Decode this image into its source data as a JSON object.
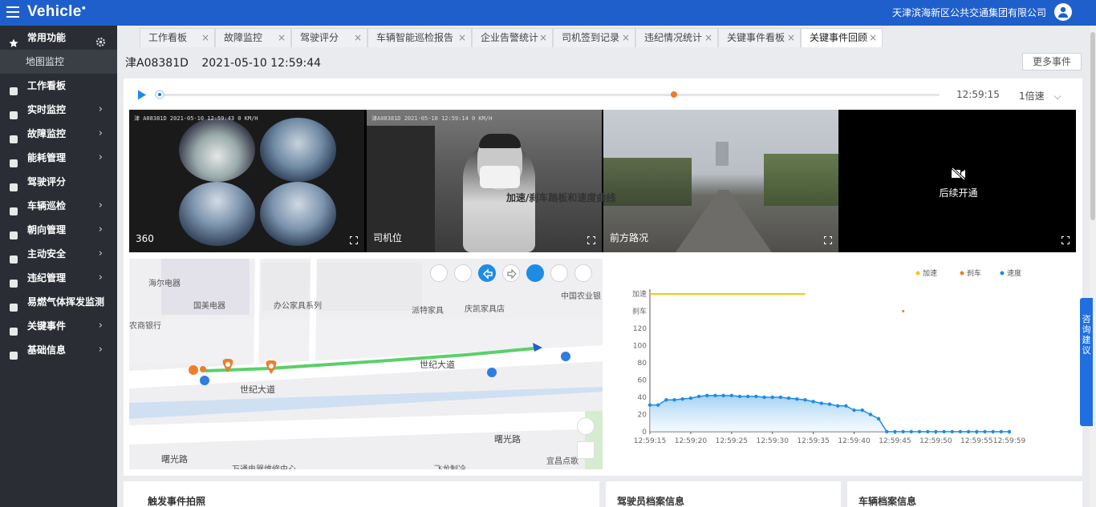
{
  "app": {
    "logo": "Vehicle",
    "company": "天津滨海新区公共交通集团有限公司"
  },
  "sidebar": {
    "items": [
      {
        "label": "常用功能",
        "icon": "star-icon",
        "expandable": false,
        "gear": true
      },
      {
        "label": "工作看板",
        "icon": "board-icon",
        "expandable": false
      },
      {
        "label": "实时监控",
        "icon": "monitor-icon",
        "expandable": true
      },
      {
        "label": "故障监控",
        "icon": "fault-icon",
        "expandable": true
      },
      {
        "label": "能耗管理",
        "icon": "energy-icon",
        "expandable": true
      },
      {
        "label": "驾驶评分",
        "icon": "steering-icon",
        "expandable": false
      },
      {
        "label": "车辆巡检",
        "icon": "bus-icon",
        "expandable": true
      },
      {
        "label": "朝向管理",
        "icon": "compass-icon",
        "expandable": true
      },
      {
        "label": "主动安全",
        "icon": "shield-icon",
        "expandable": true
      },
      {
        "label": "违纪管理",
        "icon": "violation-icon",
        "expandable": true
      },
      {
        "label": "易燃气体挥发监测",
        "icon": "gas-icon",
        "expandable": false
      },
      {
        "label": "关键事件",
        "icon": "event-icon",
        "expandable": true
      },
      {
        "label": "基础信息",
        "icon": "user-info-icon",
        "expandable": true
      }
    ],
    "sub_item": "地图监控"
  },
  "tabs": [
    {
      "label": "工作看板"
    },
    {
      "label": "故障监控"
    },
    {
      "label": "驾驶评分"
    },
    {
      "label": "车辆智能巡检报告"
    },
    {
      "label": "企业告警统计"
    },
    {
      "label": "司机签到记录"
    },
    {
      "label": "违纪情况统计"
    },
    {
      "label": "关键事件看板"
    },
    {
      "label": "关键事件回顾",
      "active": true
    }
  ],
  "header": {
    "plate": "津A08381D",
    "datetime": "2021-05-10 12:59:44",
    "more_events": "更多事件"
  },
  "player": {
    "time": "12:59:15",
    "speed": "1倍速",
    "progress": 0.0,
    "event_marker": 0.66
  },
  "videos": [
    {
      "label": "360",
      "osd": "津 A08381D   2021-05-10  12:59:43    0 KM/H"
    },
    {
      "label": "司机位",
      "osd": "津A08381D      2021-05-10 12:59:14        0 KM/H"
    },
    {
      "label": "前方路况",
      "osd": ""
    },
    {
      "label": "后续开通",
      "placeholder": true
    }
  ],
  "map": {
    "labels": [
      "海尔电器",
      "国美电器",
      "办公家具系列",
      "派特家具",
      "庆凯家具店",
      "中国农业银",
      "农商银行",
      "世纪大道",
      "世纪大道",
      "曙光路",
      "曙光路",
      "万通电器维修中心",
      "飞龙制冷",
      "宜昌点歌"
    ]
  },
  "chart_data": {
    "type": "line",
    "title": "加速/刹车踏板和速度曲线",
    "legend": [
      "加速",
      "刹车",
      "速度"
    ],
    "legend_placement": "top-right",
    "colors": {
      "加速": "#f5c518",
      "刹车": "#f07b2a",
      "速度": "#1d8ce6"
    },
    "x_ticks": [
      "12:59:15",
      "12:59:20",
      "12:59:25",
      "12:59:30",
      "12:59:35",
      "12:59:40",
      "12:59:45",
      "12:59:50",
      "12:59:55",
      "12:59:59"
    ],
    "y_ticks": [
      "0",
      "20",
      "40",
      "60",
      "80",
      "100",
      "120",
      "刹车",
      "加速"
    ],
    "ylim": [
      0,
      160
    ],
    "series": [
      {
        "name": "速度",
        "x_seconds": [
          15,
          16,
          17,
          18,
          19,
          20,
          21,
          22,
          23,
          24,
          25,
          26,
          27,
          28,
          29,
          30,
          31,
          32,
          33,
          34,
          35,
          36,
          37,
          38,
          39,
          40,
          41,
          42,
          43,
          44,
          45,
          46,
          47,
          48,
          49,
          50,
          51,
          52,
          53,
          54,
          55,
          56,
          57,
          58,
          59
        ],
        "values": [
          31,
          31,
          37,
          37,
          38,
          39,
          41,
          42,
          42,
          42,
          42,
          41,
          41,
          41,
          40,
          40,
          40,
          39,
          38,
          37,
          35,
          33,
          32,
          30,
          30,
          25,
          25,
          20,
          15,
          0,
          0,
          0,
          0,
          0,
          0,
          0,
          0,
          0,
          0,
          0,
          0,
          0,
          0,
          0,
          0
        ]
      },
      {
        "name": "加速",
        "x_start": 15,
        "x_end": 34,
        "level": "加速"
      },
      {
        "name": "刹车",
        "x_point": 46,
        "level": "刹车"
      }
    ],
    "grid": false
  },
  "cards": [
    {
      "title": "触发事件拍照"
    },
    {
      "title": "驾驶员档案信息"
    },
    {
      "title": "车辆档案信息"
    }
  ],
  "float_panel": {
    "text": "咨询建议"
  }
}
